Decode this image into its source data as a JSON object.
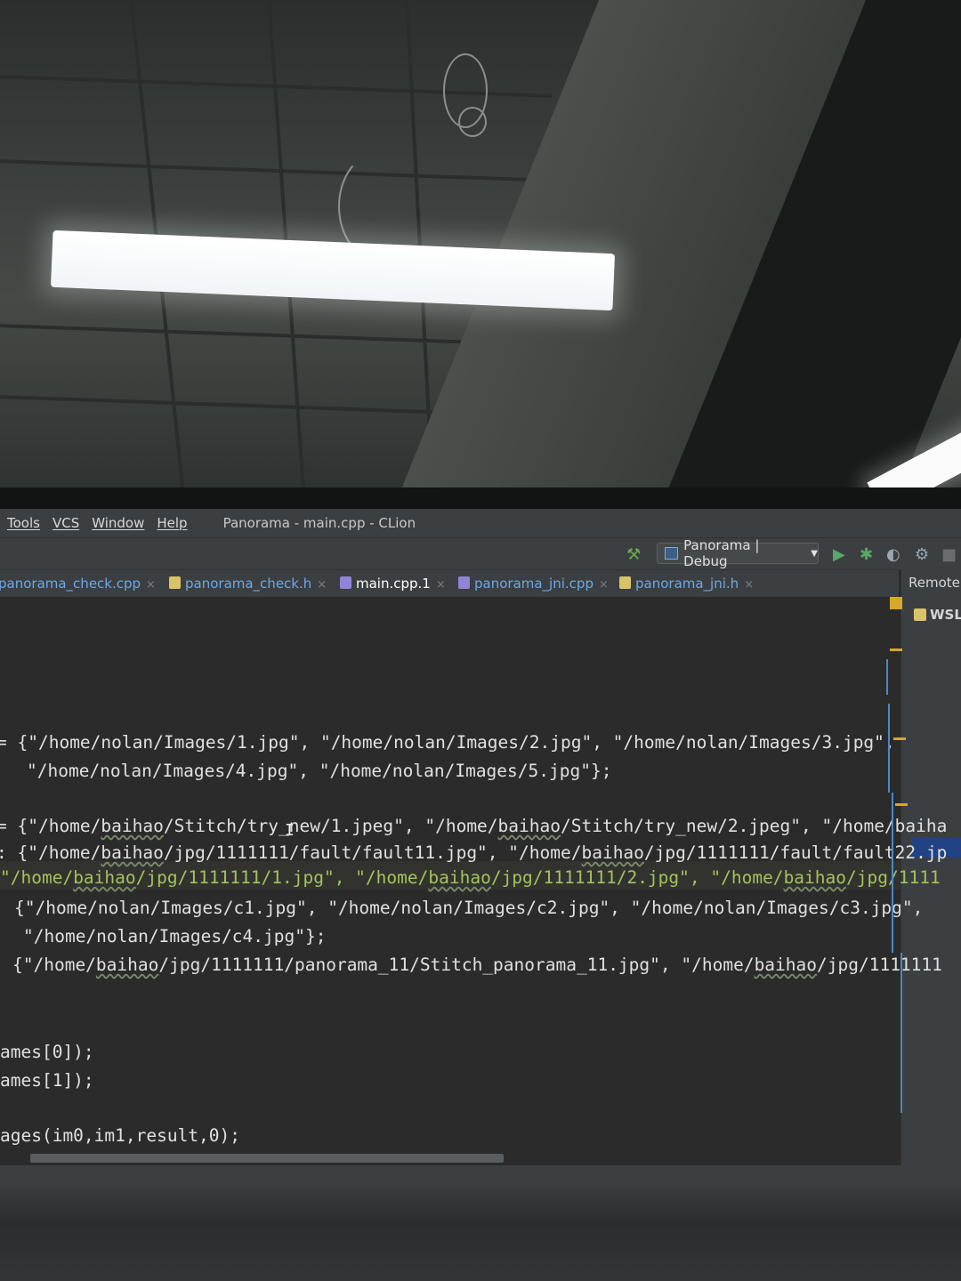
{
  "menu": [
    "Tools",
    "VCS",
    "Window",
    "Help"
  ],
  "window_title": "Panorama - main.cpp - CLion",
  "run_config": "Panorama | Debug",
  "tabs": [
    {
      "label": "panorama_check.cpp",
      "icon": "cpp-file-icon"
    },
    {
      "label": "panorama_check.h",
      "icon": "header-file-icon"
    },
    {
      "label": "main.cpp.1",
      "icon": "cpp-file-icon",
      "active": true
    },
    {
      "label": "panorama_jni.cpp",
      "icon": "cpp-file-icon"
    },
    {
      "label": "panorama_jni.h",
      "icon": "header-file-icon"
    }
  ],
  "close_glyph": "×",
  "right_pane": {
    "header": "Remote",
    "item": "WSL"
  },
  "code": {
    "l1_pre": "= {",
    "l1": "\"/home/nolan/Images/1.jpg\", \"/home/nolan/Images/2.jpg\", \"/home/nolan/Images/3.jpg\",",
    "l2": "\"/home/nolan/Images/4.jpg\", \"/home/nolan/Images/5.jpg\"};",
    "l3_a": "= {\"/home/",
    "l3_b": "baihao",
    "l3_c": "/Stitch/try_new/1.jpeg\", \"/home/",
    "l3_d": "baihao",
    "l3_e": "/Stitch/try_new/2.jpeg\", \"/home/baiha",
    "l4_a": ": {\"/home/",
    "l4_b": "baihao",
    "l4_c": "/jpg/1111111/fault/fault11.jpg\", \"/home/",
    "l4_d": "baihao",
    "l4_e": "/jpg/1111111/fault/fault22.jp",
    "l5_a": "\"/home/",
    "l5_b": "baihao",
    "l5_c": "/jpg/1111111/1.jpg\", \"/home/",
    "l5_d": "baihao",
    "l5_e": "/jpg/1111111/2.jpg\", \"/home/",
    "l5_f": "baihao",
    "l5_g": "/jpg/1111",
    "l6": "{\"/home/nolan/Images/c1.jpg\", \"/home/nolan/Images/c2.jpg\", \"/home/nolan/Images/c3.jpg\",",
    "l7": "\"/home/nolan/Images/c4.jpg\"};",
    "l8_a": "{\"/home/",
    "l8_b": "baihao",
    "l8_c": "/jpg/1111111/panorama_11/Stitch_panorama_11.jpg\", \"/home/",
    "l8_d": "baihao",
    "l8_e": "/jpg/1111111",
    "l9": "ames[0]);",
    "l10": "ames[1]);",
    "l11": "ages(im0,im1,result,0);"
  },
  "colors": {
    "editor_bg": "#2b2b2b",
    "string_green": "#a5c25c",
    "tab_blue": "#6ea8e6"
  }
}
